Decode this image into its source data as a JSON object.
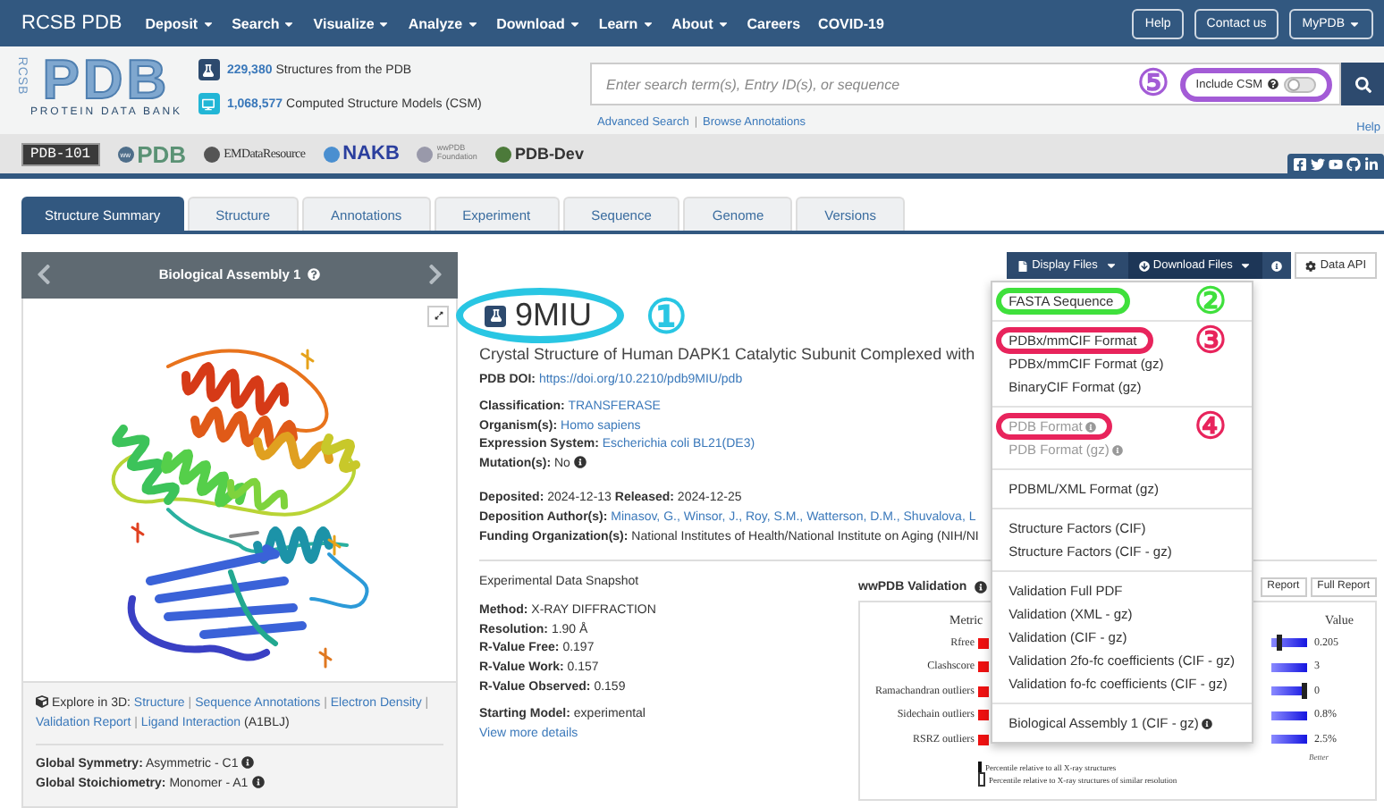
{
  "top_nav": {
    "brand": "RCSB PDB",
    "menu": [
      {
        "label": "Deposit",
        "dropdown": true
      },
      {
        "label": "Search",
        "dropdown": true
      },
      {
        "label": "Visualize",
        "dropdown": true
      },
      {
        "label": "Analyze",
        "dropdown": true
      },
      {
        "label": "Download",
        "dropdown": true
      },
      {
        "label": "Learn",
        "dropdown": true
      },
      {
        "label": "About",
        "dropdown": true
      },
      {
        "label": "Careers",
        "dropdown": false
      },
      {
        "label": "COVID-19",
        "dropdown": false
      }
    ],
    "buttons": [
      {
        "label": "Help",
        "dropdown": false
      },
      {
        "label": "Contact us",
        "dropdown": false
      },
      {
        "label": "MyPDB",
        "dropdown": true
      }
    ]
  },
  "header": {
    "logo": {
      "side": "RCSB",
      "main": "PDB",
      "tagline": "PROTEIN DATA BANK"
    },
    "stats": [
      {
        "kind": "experimental",
        "count": "229,380",
        "label": "Structures from the PDB"
      },
      {
        "kind": "computed",
        "count": "1,068,577",
        "label": "Computed Structure Models (CSM)"
      }
    ],
    "search": {
      "placeholder": "Enter search term(s), Entry ID(s), or sequence",
      "include_csm": {
        "label": "Include CSM",
        "on": false,
        "callout": {
          "label": "⑤",
          "color": "#a35bd6"
        }
      }
    },
    "links": [
      "Advanced Search",
      "Browse Annotations"
    ],
    "link_separator": "|",
    "help": "Help"
  },
  "partners": [
    {
      "kind": "boxed",
      "label": "PDB-101"
    },
    {
      "kind": "ww",
      "prefix": "ww",
      "label": "PDB"
    },
    {
      "kind": "emdb",
      "label": "EMDataResource"
    },
    {
      "kind": "nakb",
      "label": "NAKB"
    },
    {
      "kind": "foundation",
      "prefix": "wwPDB",
      "label": "Foundation"
    },
    {
      "kind": "dev",
      "label": "PDB-Dev"
    }
  ],
  "tabs": [
    {
      "label": "Structure Summary",
      "selected": true
    },
    {
      "label": "Structure",
      "selected": false
    },
    {
      "label": "Annotations",
      "selected": false
    },
    {
      "label": "Experiment",
      "selected": false
    },
    {
      "label": "Sequence",
      "selected": false
    },
    {
      "label": "Genome",
      "selected": false
    },
    {
      "label": "Versions",
      "selected": false
    }
  ],
  "assembly_panel": {
    "title": "Biological Assembly 1",
    "explore": {
      "label": "Explore in 3D:",
      "links": [
        "Structure",
        "Sequence Annotations",
        "Electron Density",
        "Validation Report",
        "Ligand Interaction"
      ],
      "separator": "|",
      "suffix": "(A1BLJ)"
    },
    "global": [
      {
        "label": "Global Symmetry:",
        "value": "Asymmetric - C1"
      },
      {
        "label": "Global Stoichiometry:",
        "value": "Monomer - A1"
      }
    ]
  },
  "file_buttons": [
    {
      "kind": "file",
      "label": "Display Files",
      "open": false
    },
    {
      "kind": "download",
      "label": "Download Files",
      "open": true
    }
  ],
  "data_api": "Data API",
  "download_menu": {
    "groups": [
      {
        "items": [
          {
            "label": "FASTA Sequence",
            "disabled": false,
            "info": false,
            "callout": {
              "label": "②",
              "color": "#3fe03c"
            }
          }
        ]
      },
      {
        "items": [
          {
            "label": "PDBx/mmCIF Format",
            "disabled": false,
            "info": false,
            "callout": {
              "label": "③",
              "color": "#e8245c"
            }
          },
          {
            "label": "PDBx/mmCIF Format (gz)",
            "disabled": false,
            "info": false
          },
          {
            "label": "BinaryCIF Format (gz)",
            "disabled": false,
            "info": false
          }
        ]
      },
      {
        "items": [
          {
            "label": "PDB Format",
            "disabled": true,
            "info": true,
            "callout": {
              "label": "④",
              "color": "#e8245c"
            }
          },
          {
            "label": "PDB Format (gz)",
            "disabled": true,
            "info": true
          }
        ]
      },
      {
        "items": [
          {
            "label": "PDBML/XML Format (gz)",
            "disabled": false,
            "info": false
          }
        ]
      },
      {
        "items": [
          {
            "label": "Structure Factors (CIF)",
            "disabled": false,
            "info": false
          },
          {
            "label": "Structure Factors (CIF - gz)",
            "disabled": false,
            "info": false
          }
        ]
      },
      {
        "items": [
          {
            "label": "Validation Full PDF",
            "disabled": false,
            "info": false
          },
          {
            "label": "Validation (XML - gz)",
            "disabled": false,
            "info": false
          },
          {
            "label": "Validation (CIF - gz)",
            "disabled": false,
            "info": false
          },
          {
            "label": "Validation 2fo-fc coefficients (CIF - gz)",
            "disabled": false,
            "info": false
          },
          {
            "label": "Validation fo-fc coefficients (CIF - gz)",
            "disabled": false,
            "info": false
          }
        ]
      },
      {
        "items": [
          {
            "label": "Biological Assembly 1 (CIF - gz)",
            "disabled": false,
            "info": true
          }
        ]
      }
    ]
  },
  "entry": {
    "id": "9MIU",
    "callout": {
      "label": "①",
      "color": "#29c6e3"
    },
    "title": "Crystal Structure of Human DAPK1 Catalytic Subunit Complexed with",
    "doi": {
      "label": "PDB DOI:",
      "value": "https://doi.org/10.2210/pdb9MIU/pdb"
    },
    "facts": [
      {
        "parts": [
          {
            "label": "Classification:",
            "value": "TRANSFERASE",
            "link": true,
            "info": false
          }
        ]
      },
      {
        "parts": [
          {
            "label": "Organism(s):",
            "value": "Homo sapiens",
            "link": true,
            "info": false
          }
        ]
      },
      {
        "parts": [
          {
            "label": "Expression System:",
            "value": "Escherichia coli BL21(DE3)",
            "link": true,
            "info": false
          }
        ]
      },
      {
        "parts": [
          {
            "label": "Mutation(s):",
            "value": "No",
            "link": false,
            "info": true
          }
        ]
      }
    ],
    "dates": [
      {
        "parts": [
          {
            "label": "Deposited:",
            "value": "2024-12-13",
            "link": false,
            "info": false
          },
          {
            "label": "Released:",
            "value": "2024-12-25",
            "link": false,
            "info": false
          }
        ]
      },
      {
        "parts": [
          {
            "label": "Deposition Author(s):",
            "value": "Minasov, G., Winsor, J., Roy, S.M., Watterson, D.M., Shuvalova, L",
            "link": true,
            "info": false
          }
        ]
      },
      {
        "parts": [
          {
            "label": "Funding Organization(s):",
            "value": "National Institutes of Health/National Institute on Aging (NIH/NI",
            "link": false,
            "info": false
          }
        ]
      }
    ]
  },
  "snapshot": {
    "title": "Experimental Data Snapshot",
    "rows": [
      {
        "parts": [
          {
            "label": "Method:",
            "value": "X-RAY DIFFRACTION",
            "link": false,
            "info": false
          }
        ]
      },
      {
        "parts": [
          {
            "label": "Resolution:",
            "value": "1.90 Å",
            "link": false,
            "info": false
          }
        ]
      },
      {
        "parts": [
          {
            "label": "R-Value Free:",
            "value": "0.197",
            "link": false,
            "info": false
          }
        ]
      },
      {
        "parts": [
          {
            "label": "R-Value Work:",
            "value": "0.157",
            "link": false,
            "info": false
          }
        ]
      },
      {
        "parts": [
          {
            "label": "R-Value Observed:",
            "value": "0.159",
            "link": false,
            "info": false
          }
        ]
      }
    ],
    "starting_model": {
      "parts": [
        {
          "label": "Starting Model:",
          "value": "experimental",
          "link": false,
          "info": false
        }
      ]
    },
    "more_link": "View more details"
  },
  "validation": {
    "title": "wwPDB Validation",
    "buttons": [
      "Report",
      "Full Report"
    ],
    "metric_header": "Metric",
    "value_header": "Value",
    "metrics": [
      {
        "name": "Rfree",
        "value": "0.205",
        "marker": true
      },
      {
        "name": "Clashscore",
        "value": "3",
        "marker": false
      },
      {
        "name": "Ramachandran outliers",
        "value": "0",
        "marker": true
      },
      {
        "name": "Sidechain outliers",
        "value": "0.8%",
        "marker": false
      },
      {
        "name": "RSRZ outliers",
        "value": "2.5%",
        "marker": false
      }
    ],
    "better_label": "Better",
    "legend": [
      {
        "kind": "all",
        "label": "Percentile relative to all X-ray structures"
      },
      {
        "kind": "similar",
        "label": "Percentile relative to X-ray structures of similar resolution"
      }
    ]
  }
}
